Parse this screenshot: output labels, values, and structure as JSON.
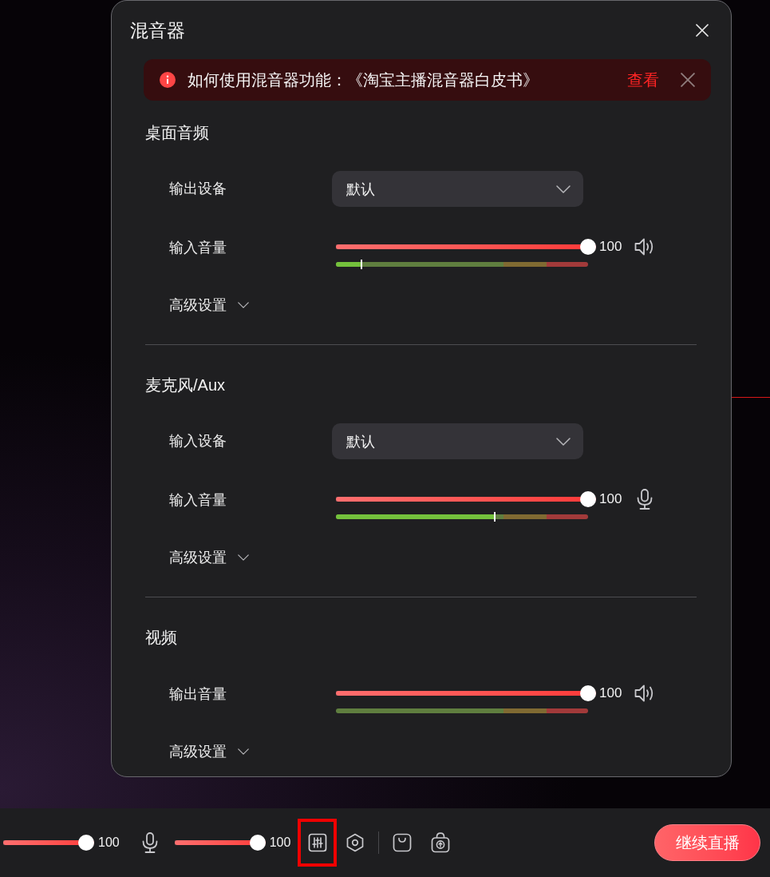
{
  "dialog": {
    "title": "混音器",
    "notice": {
      "text": "如何使用混音器功能：《淘宝主播混音器白皮书》",
      "link": "查看"
    },
    "sections": [
      {
        "title": "桌面音频",
        "rows": [
          {
            "kind": "select",
            "label": "输出设备",
            "value": "默认"
          },
          {
            "kind": "speaker",
            "label": "输入音量",
            "slider": {
              "level": 1
            },
            "reading": "100",
            "meter": {
              "level": 0.1
            }
          },
          {
            "kind": "advanced",
            "label": "高级设置",
            "expanded": false
          }
        ]
      },
      {
        "title": "麦克风/Aux",
        "rows": [
          {
            "kind": "select",
            "label": "输入设备",
            "value": "默认"
          },
          {
            "kind": "microphone",
            "label": "输入音量",
            "slider": {
              "level": 1
            },
            "reading": "100",
            "meter": {
              "level": 0.63
            }
          },
          {
            "kind": "advanced",
            "label": "高级设置",
            "expanded": false
          }
        ]
      },
      {
        "title": "视频",
        "rows": [
          {
            "kind": "speaker",
            "label": "输出音量",
            "slider": {
              "level": 1
            },
            "reading": "100"
          },
          {
            "kind": "advanced",
            "label": "高级设置",
            "expanded": false
          }
        ]
      }
    ]
  },
  "toolbar": {
    "items": [
      {
        "kind": "slider",
        "level": 1,
        "reading": "100",
        "highlighted": false
      },
      {
        "kind": "microphone",
        "highlighted": false
      },
      {
        "kind": "slider",
        "level": 1,
        "reading": "100",
        "highlighted": false
      },
      {
        "kind": "mixer",
        "highlighted": true
      },
      {
        "kind": "hexagon",
        "highlighted": false
      },
      {
        "kind": "divider"
      },
      {
        "kind": "bag",
        "highlighted": false
      },
      {
        "kind": "upload",
        "highlighted": false
      }
    ],
    "primary_button": "继续直播"
  }
}
